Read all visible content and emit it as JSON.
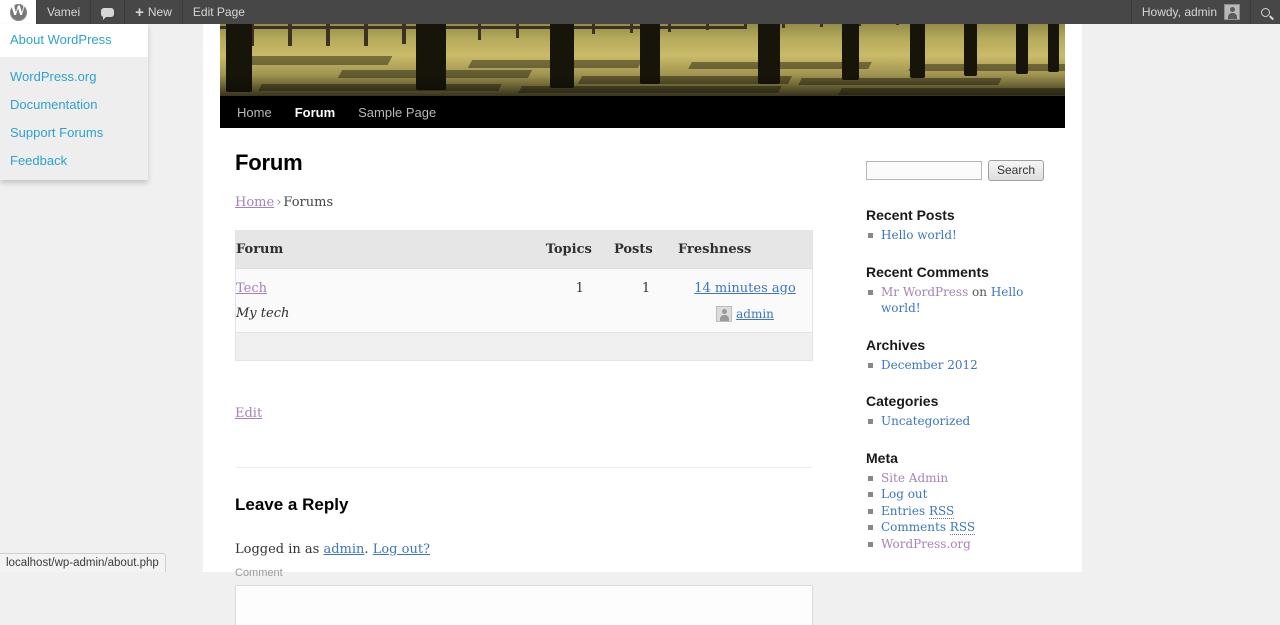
{
  "adminbar": {
    "logo_icon": "wordpress-logo-icon",
    "site_name": "Vamei",
    "comments_icon": "comment-bubble-icon",
    "new_label": "New",
    "new_plus": "+",
    "edit_page_label": "Edit Page",
    "howdy": "Howdy, admin",
    "avatar_icon": "user-avatar-icon",
    "search_icon": "search-icon"
  },
  "wp_dropdown": {
    "about": "About WordPress",
    "links": [
      "WordPress.org",
      "Documentation",
      "Support Forums",
      "Feedback"
    ]
  },
  "nav": {
    "items": [
      {
        "label": "Home",
        "active": false
      },
      {
        "label": "Forum",
        "active": true
      },
      {
        "label": "Sample Page",
        "active": false
      }
    ]
  },
  "content": {
    "title": "Forum",
    "breadcrumb": {
      "home": "Home",
      "separator": "›",
      "current": "Forums"
    },
    "forum_table": {
      "headers": {
        "forum": "Forum",
        "topics": "Topics",
        "posts": "Posts",
        "freshness": "Freshness"
      },
      "rows": [
        {
          "name": "Tech",
          "description": "My tech",
          "topics": "1",
          "posts": "1",
          "freshness": "14 minutes ago",
          "author": "admin",
          "author_avatar_icon": "user-avatar-icon"
        }
      ]
    },
    "edit_label": "Edit",
    "reply": {
      "title": "Leave a Reply",
      "logged_in_prefix": "Logged in as",
      "user": "admin",
      "period": ".",
      "logout": "Log out?",
      "comment_label": "Comment",
      "comment_value": ""
    }
  },
  "sidebar": {
    "search": {
      "value": "",
      "placeholder": "",
      "button": "Search"
    },
    "widgets": [
      {
        "title": "Recent Posts",
        "items": [
          {
            "text": "Hello world!",
            "color": "blue"
          }
        ]
      },
      {
        "title": "Recent Comments",
        "items": [
          {
            "text": "Mr WordPress",
            "color": "purple",
            "middle": " on ",
            "text2": "Hello world!",
            "color2": "blue"
          }
        ]
      },
      {
        "title": "Archives",
        "items": [
          {
            "text": "December 2012",
            "color": "blue"
          }
        ]
      },
      {
        "title": "Categories",
        "items": [
          {
            "text": "Uncategorized",
            "color": "blue"
          }
        ]
      },
      {
        "title": "Meta",
        "items": [
          {
            "text": "Site Admin",
            "color": "purple"
          },
          {
            "text": "Log out",
            "color": "blue"
          },
          {
            "text": "Entries ",
            "color": "blue",
            "abbr": "RSS"
          },
          {
            "text": "Comments ",
            "color": "blue",
            "abbr": "RSS"
          },
          {
            "text": "WordPress.org",
            "color": "purple"
          }
        ]
      }
    ]
  },
  "statusbar": {
    "url": "localhost/wp-admin/about.php"
  },
  "colors": {
    "adminbar_bg": "#474747",
    "link_blue": "#3a76c4",
    "link_purple": "#a682b8",
    "dropdown_link": "#2ea2cc",
    "page_bg": "#f0f0f0",
    "nav_bg": "#000000"
  }
}
